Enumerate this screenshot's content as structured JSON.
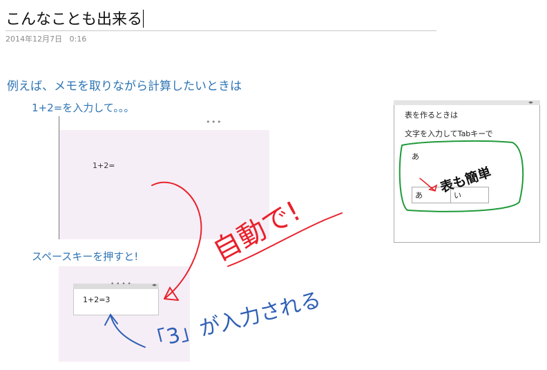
{
  "page": {
    "title": "こんなことも出来る",
    "date": "2014年12月7日",
    "time": "0:16",
    "heading": "例えば、メモを取りながら計算したいときは",
    "step1": "1+2=を入力して。。。",
    "step2": "スペースキーを押すと!"
  },
  "screenshot1": {
    "handle": "• • •",
    "formula": "1+2="
  },
  "screenshot2": {
    "handle": "• • • •",
    "arrows": "◂▸",
    "formula": "1+2=3"
  },
  "panel": {
    "arrows": "◂▸",
    "line1": "表を作るときは",
    "line2": "文字を入力してTabキーで",
    "cell_text": "あ",
    "table_cells": [
      "あ",
      "い"
    ]
  },
  "ink": {
    "red_text": "自動で!",
    "blue_text": "「3」が入力される",
    "green_text": "表も簡単",
    "colors": {
      "red": "#e8212b",
      "blue": "#2f5fb5",
      "green": "#1f9a3a",
      "black": "#111111"
    }
  }
}
